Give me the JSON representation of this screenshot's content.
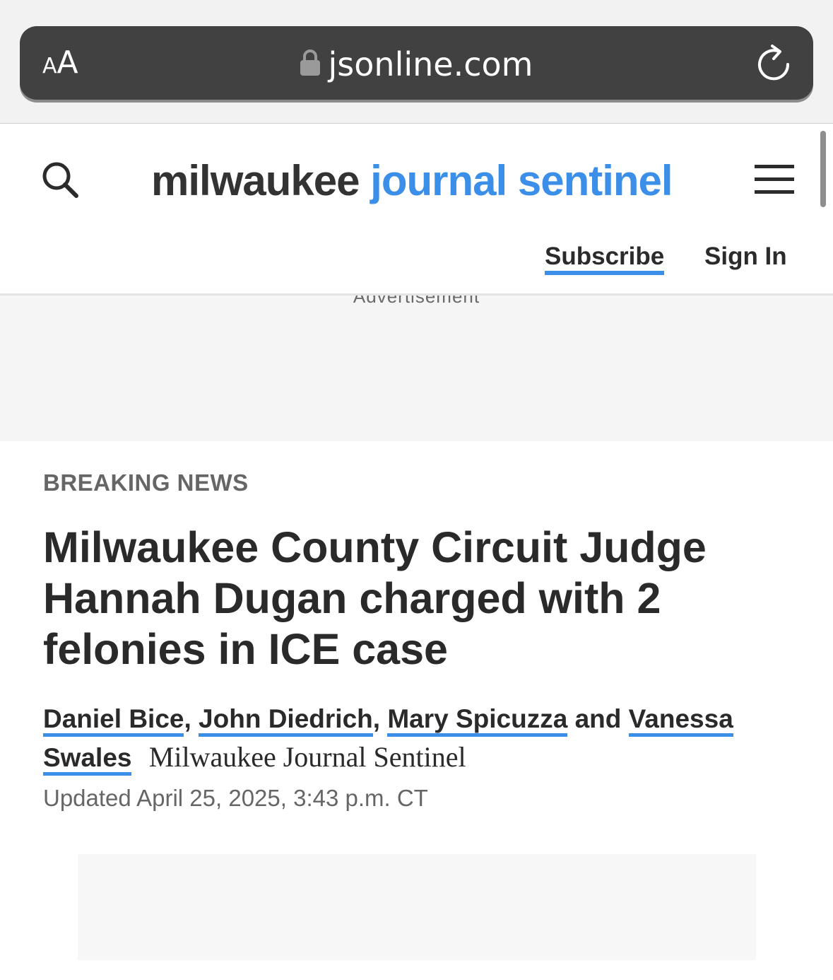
{
  "browser": {
    "text_size_small": "A",
    "text_size_big": "A",
    "url": "jsonline.com"
  },
  "header": {
    "logo_part1": "milwaukee",
    "logo_part2": "journal sentinel",
    "subscribe_label": "Subscribe",
    "signin_label": "Sign In"
  },
  "ad": {
    "label": "Advertisement"
  },
  "article": {
    "kicker": "BREAKING NEWS",
    "headline": "Milwaukee County Circuit Judge Hannah Dugan charged with 2 felonies in ICE case",
    "authors": [
      "Daniel Bice",
      "John Diedrich",
      "Mary Spicuzza",
      "Vanessa Swales"
    ],
    "separator": ",",
    "conjunction": "and",
    "publication": "Milwaukee Journal Sentinel",
    "updated": "Updated April 25, 2025, 3:43 p.m. CT"
  },
  "colors": {
    "accent": "#3c8fe8",
    "text": "#2a2a2a",
    "address_bar": "#414141"
  },
  "icons": {
    "search": "search-icon",
    "menu": "hamburger-menu-icon",
    "lock": "lock-icon",
    "reload": "reload-icon"
  }
}
